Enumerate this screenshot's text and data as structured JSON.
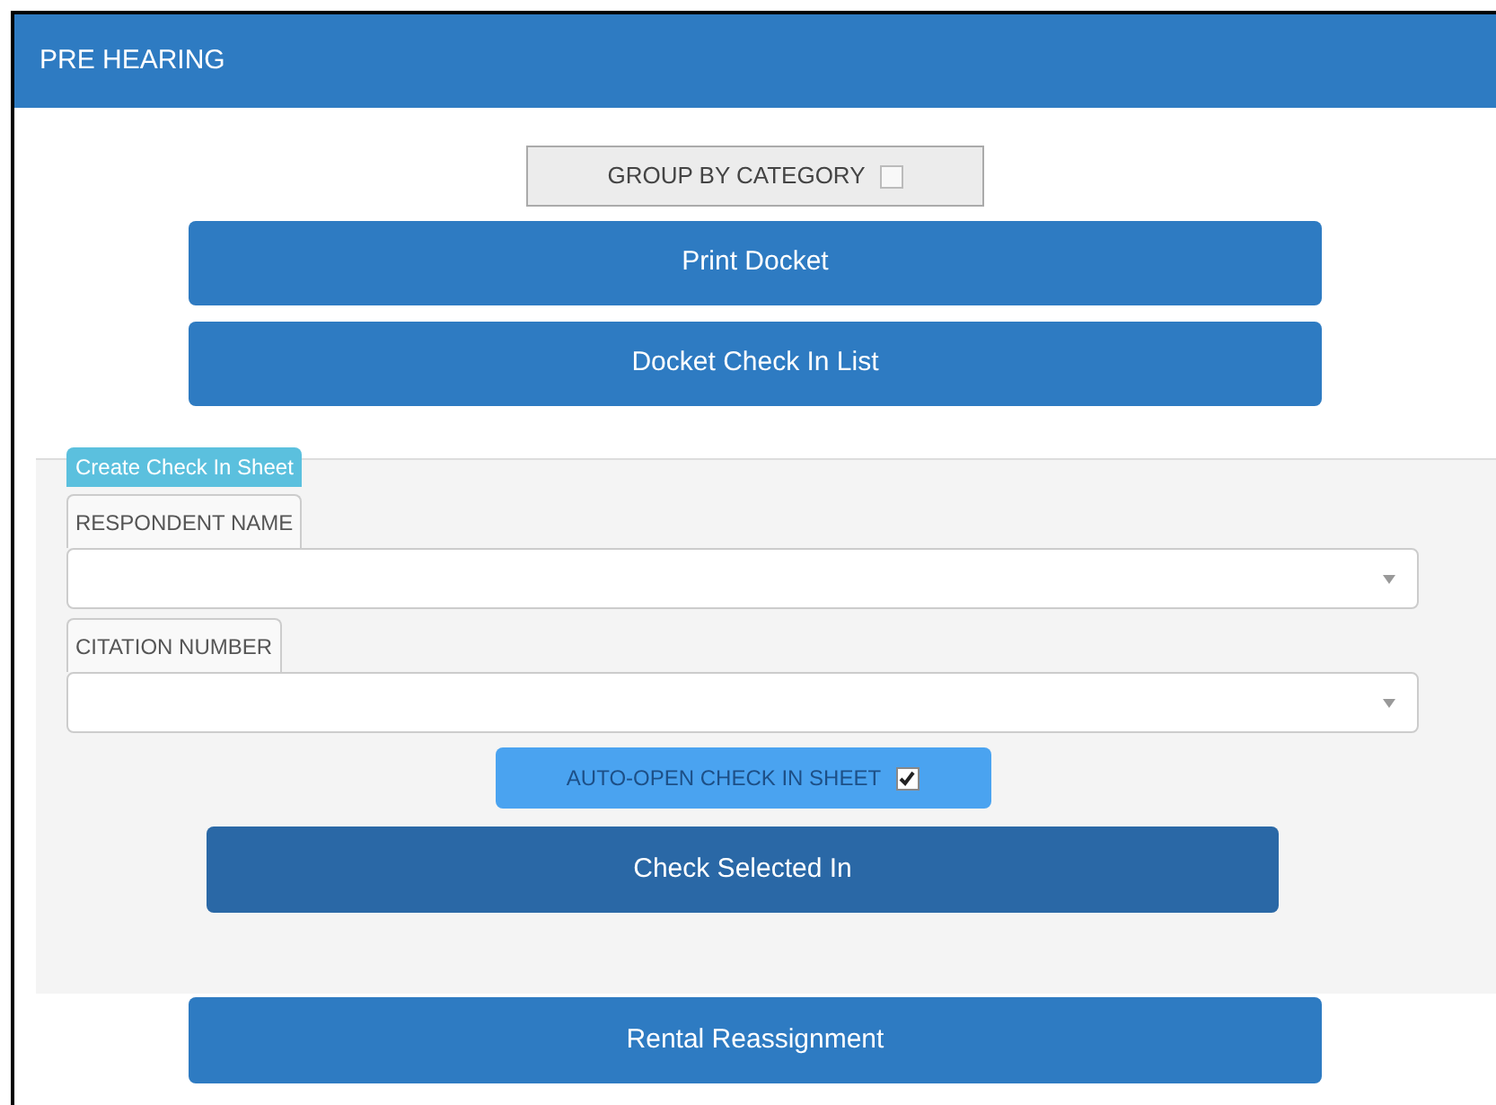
{
  "header": {
    "title": "PRE HEARING"
  },
  "group_toggle": {
    "label": "GROUP BY CATEGORY",
    "checked": false
  },
  "top_buttons": [
    "Print Docket",
    "Docket Check In List"
  ],
  "check_in_panel": {
    "legend": "Create Check In Sheet",
    "fields": [
      {
        "label": "RESPONDENT NAME"
      },
      {
        "label": "CITATION NUMBER"
      }
    ],
    "auto_open": {
      "label": "AUTO-OPEN CHECK IN SHEET",
      "checked": true
    },
    "submit": "Check Selected In"
  },
  "bottom_button": "Rental Reassignment"
}
